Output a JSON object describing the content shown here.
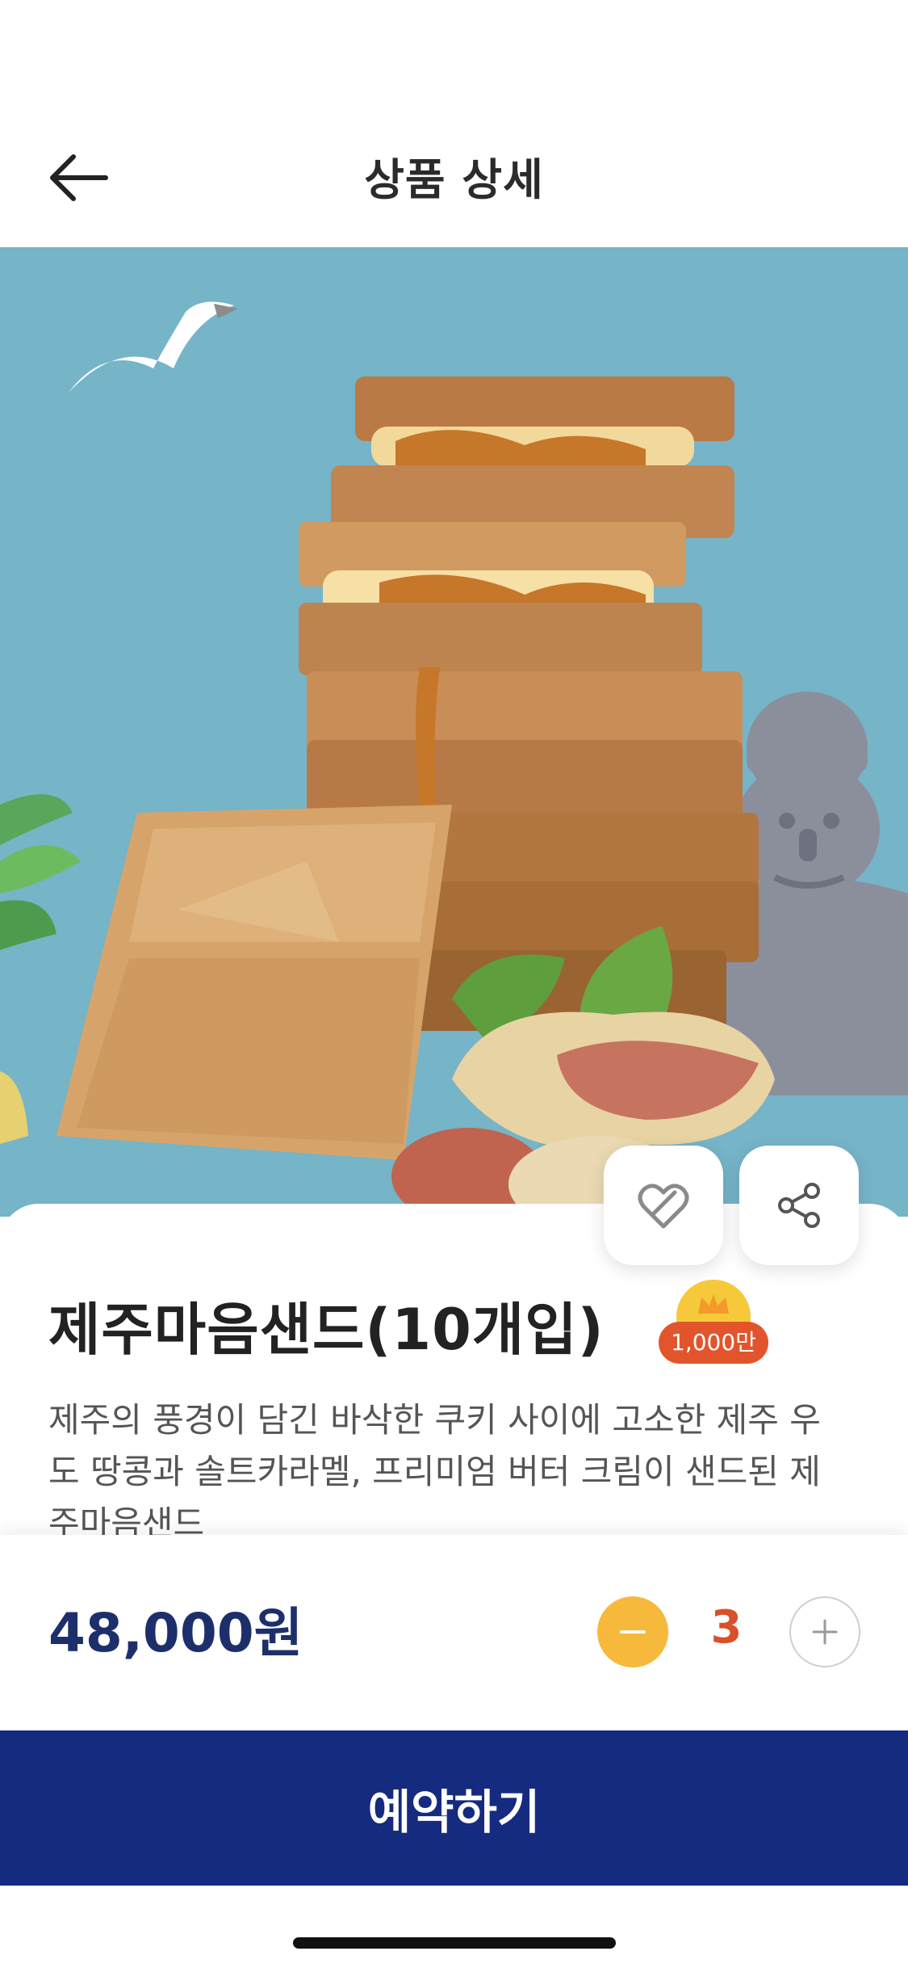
{
  "header": {
    "title": "상품 상세",
    "back_icon": "arrow-left-icon"
  },
  "hero": {
    "image_description": "product-photo",
    "background_color": "#76b4c8"
  },
  "actions": {
    "like_icon": "heart-outline-icon",
    "share_icon": "share-icon"
  },
  "product": {
    "name": "제주마음샌드(10개입)",
    "badge_label": "1,000만",
    "badge_icon": "crown-icon",
    "description": "제주의 풍경이 담긴 바삭한 쿠키 사이에 고소한 제주 우도 땅콩과 솔트카라멜, 프리미엄 버터 크림이 샌드된 제주마음샌드"
  },
  "purchase": {
    "price": "48,000원",
    "quantity": "3",
    "minus_icon": "minus-icon",
    "plus_icon": "plus-icon",
    "reserve_label": "예약하기"
  },
  "colors": {
    "accent_navy": "#152b80",
    "price_text": "#1d2f6b",
    "quantity_text": "#d9502a",
    "minus_bg": "#f6b93b",
    "badge_pill": "#e2552c"
  }
}
